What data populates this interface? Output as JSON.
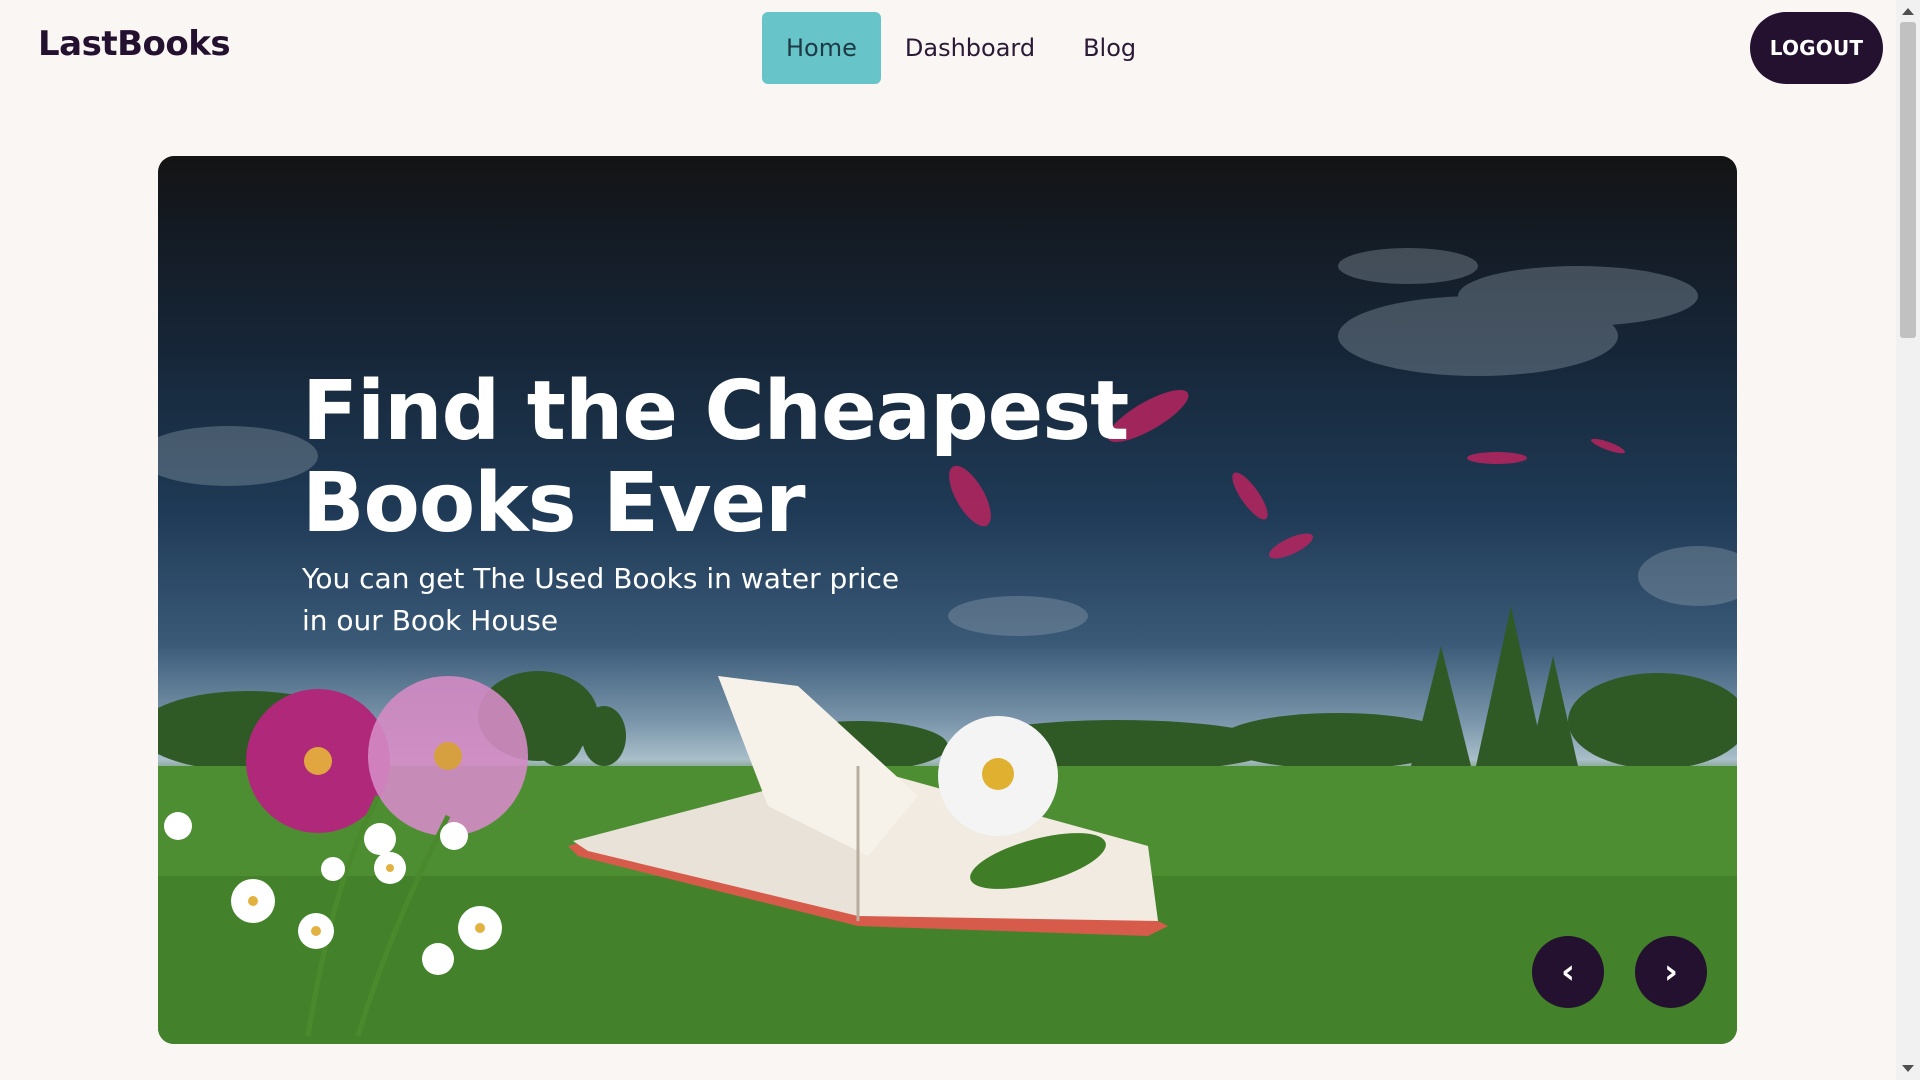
{
  "navbar": {
    "brand": "LastBooks",
    "links": [
      {
        "label": "Home",
        "active": true
      },
      {
        "label": "Dashboard",
        "active": false
      },
      {
        "label": "Blog",
        "active": false
      }
    ],
    "logout_label": "LOGOUT"
  },
  "hero": {
    "title_line1": "Find the Cheapest",
    "title_line2": "Books Ever",
    "subtitle": "You can get The Used Books in water price in our Book House",
    "prev_icon": "‹",
    "next_icon": "›"
  },
  "colors": {
    "brand_dark": "#24102f",
    "nav_active": "#67c4c8",
    "page_bg": "#f9f6f4"
  }
}
